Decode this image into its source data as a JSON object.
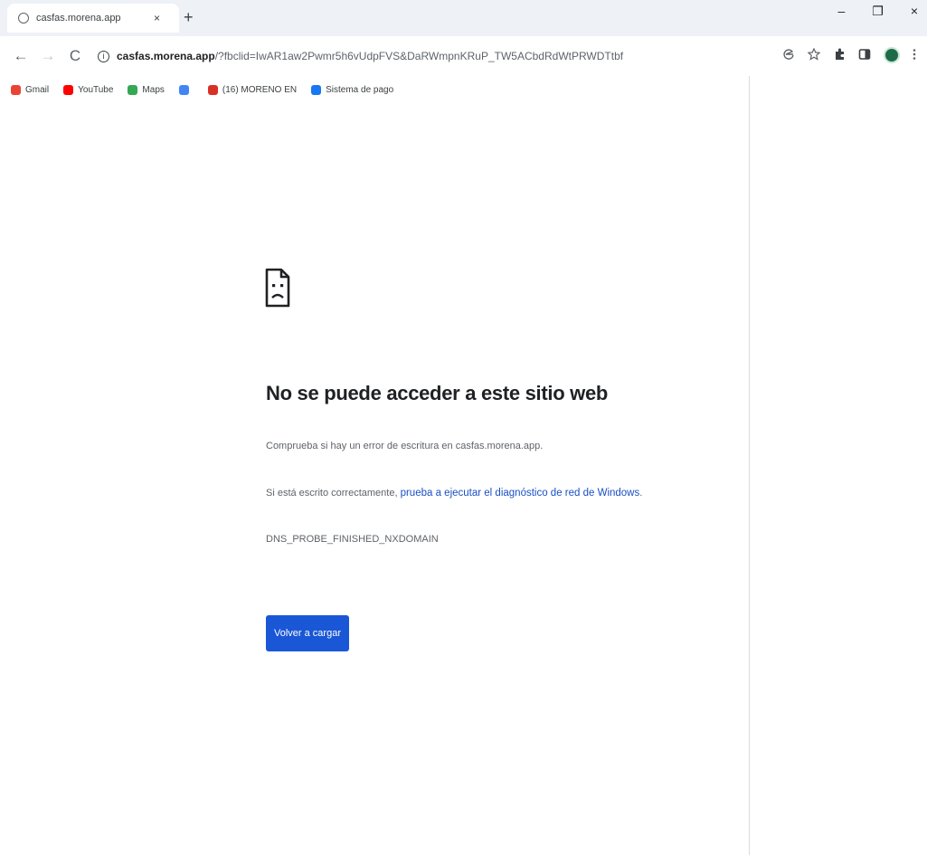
{
  "tab": {
    "title": "casfas.morena.app",
    "close_glyph": "×",
    "new_tab_glyph": "+"
  },
  "window_controls": {
    "minimize": "–",
    "maximize": "❐",
    "close": "×"
  },
  "toolbar": {
    "back_glyph": "←",
    "forward_glyph": "→",
    "reload_glyph": "C",
    "url_host": "casfas.morena.app",
    "url_path": "/?fbclid=IwAR1aw2Pwmr5h6vUdpFVS&DaRWmpnKRuP_TW5ACbdRdWtPRWDTtbf"
  },
  "bookmarks": [
    {
      "label": "Gmail",
      "icon": "gmail-icon",
      "color": "#ea4335"
    },
    {
      "label": "YouTube",
      "icon": "youtube-icon",
      "color": "#ff0000"
    },
    {
      "label": "Maps",
      "icon": "maps-icon",
      "color": "#34a853"
    },
    {
      "label": "",
      "icon": "folder-icon",
      "color": "#4285f4"
    },
    {
      "label": "(16) MORENO EN",
      "icon": "bookmark-icon",
      "color": "#d93025"
    },
    {
      "label": "Sistema de pago",
      "icon": "meta-icon",
      "color": "#1877f2"
    }
  ],
  "error": {
    "title": "No se puede acceder a este sitio web",
    "line1": "Comprueba si hay un error de escritura en casfas.morena.app.",
    "line2_prefix": "Si está escrito correctamente,",
    "line2_link": "prueba a ejecutar el diagnóstico de red de Windows",
    "line2_suffix": ".",
    "code": "DNS_PROBE_FINISHED_NXDOMAIN",
    "reload_label": "Volver a cargar"
  },
  "colors": {
    "accent": "#1a57d6",
    "link": "#1a4fc4",
    "tabstrip": "#eef1f6"
  }
}
